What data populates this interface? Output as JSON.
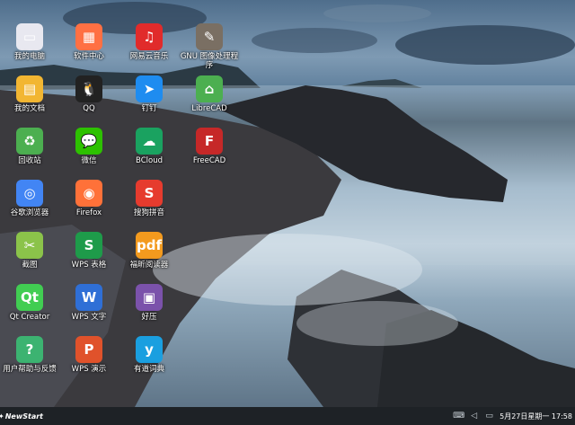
{
  "desktop": {
    "icons": [
      {
        "label": "我的电脑",
        "icon": "computer-icon",
        "color": "#e8e8f0",
        "glyph": "▭"
      },
      {
        "label": "我的文档",
        "icon": "folder-icon",
        "color": "#f2b632",
        "glyph": "▤"
      },
      {
        "label": "回收站",
        "icon": "recycle-bin-icon",
        "color": "#4caf50",
        "glyph": "♻"
      },
      {
        "label": "谷歌浏览器",
        "icon": "chrome-icon",
        "color": "#4285f4",
        "glyph": "◎"
      },
      {
        "label": "截图",
        "icon": "screenshot-icon",
        "color": "#8bc34a",
        "glyph": "✂"
      },
      {
        "label": "Qt Creator",
        "icon": "qt-creator-icon",
        "color": "#41cd52",
        "glyph": "Qt"
      },
      {
        "label": "用户帮助与反馈",
        "icon": "help-feedback-icon",
        "color": "#3cb371",
        "glyph": "?"
      },
      {
        "label": "软件中心",
        "icon": "software-center-icon",
        "color": "#ff7043",
        "glyph": "▦"
      },
      {
        "label": "QQ",
        "icon": "qq-icon",
        "color": "#222222",
        "glyph": "🐧"
      },
      {
        "label": "微信",
        "icon": "wechat-icon",
        "color": "#2dc100",
        "glyph": "💬"
      },
      {
        "label": "Firefox",
        "icon": "firefox-icon",
        "color": "#ff7139",
        "glyph": "◉"
      },
      {
        "label": "WPS 表格",
        "icon": "wps-spreadsheet-icon",
        "color": "#1e9b4a",
        "glyph": "S"
      },
      {
        "label": "WPS 文字",
        "icon": "wps-writer-icon",
        "color": "#2f6fd6",
        "glyph": "W"
      },
      {
        "label": "WPS 演示",
        "icon": "wps-presentation-icon",
        "color": "#e0522b",
        "glyph": "P"
      },
      {
        "label": "网易云音乐",
        "icon": "netease-music-icon",
        "color": "#e12b2b",
        "glyph": "♫"
      },
      {
        "label": "钉钉",
        "icon": "dingtalk-icon",
        "color": "#1e8cf0",
        "glyph": "➤"
      },
      {
        "label": "BCloud",
        "icon": "bcloud-icon",
        "color": "#1aa260",
        "glyph": "☁"
      },
      {
        "label": "搜狗拼音",
        "icon": "sogou-pinyin-icon",
        "color": "#e63b2e",
        "glyph": "S"
      },
      {
        "label": "福昕阅读器",
        "icon": "foxit-reader-icon",
        "color": "#f39a1e",
        "glyph": "pdf"
      },
      {
        "label": "好压",
        "icon": "haozip-icon",
        "color": "#7b52ab",
        "glyph": "▣"
      },
      {
        "label": "有道词典",
        "icon": "youdao-dict-icon",
        "color": "#1a9fe0",
        "glyph": "y"
      },
      {
        "label": "GNU 图像处理程序",
        "icon": "gimp-icon",
        "color": "#7a6f63",
        "glyph": "✎"
      },
      {
        "label": "LibreCAD",
        "icon": "librecad-icon",
        "color": "#4caf50",
        "glyph": "⌂"
      },
      {
        "label": "FreeCAD",
        "icon": "freecad-icon",
        "color": "#c62828",
        "glyph": "F"
      }
    ]
  },
  "taskbar": {
    "start_label": "NewStart",
    "start_icon": "newstart-logo-icon",
    "tray": {
      "icons": [
        "keyboard-icon",
        "volume-icon",
        "network-icon"
      ],
      "datetime": "5月27日星期一 17:58"
    }
  }
}
